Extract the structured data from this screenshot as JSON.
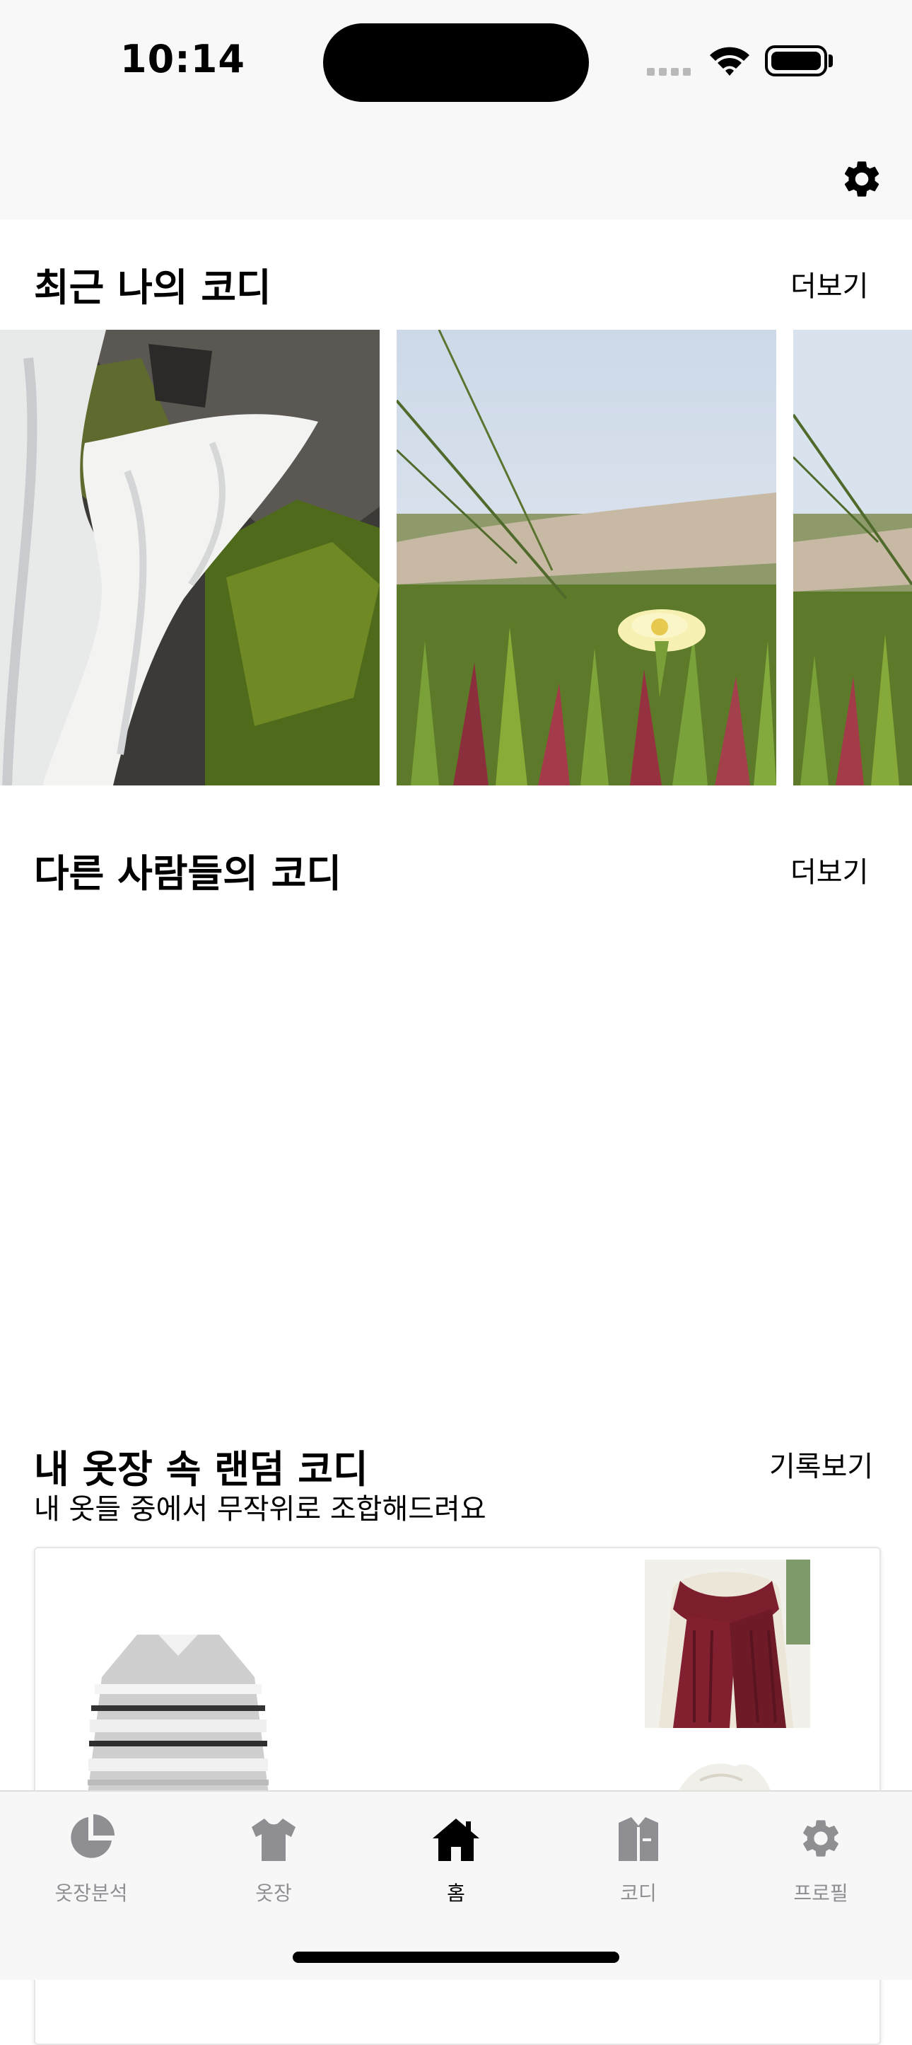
{
  "status_bar": {
    "time": "10:14"
  },
  "top_nav": {
    "settings_icon": "gear-icon"
  },
  "recent": {
    "title": "최근 나의 코디",
    "more_label": "더보기",
    "photos": [
      "waterfall-photo",
      "iceplant-flower-photo",
      "iceplant-flower-photo"
    ]
  },
  "others": {
    "title": "다른 사람들의 코디",
    "more_label": "더보기"
  },
  "random": {
    "title": "내 옷장 속 랜덤 코디",
    "history_label": "기록보기",
    "subtitle": "내 옷들 중에서 무작위로 조합해드려요",
    "items": [
      "striped-sweater",
      "burgundy-knit-scarf",
      "white-item"
    ]
  },
  "tabs": [
    {
      "label": "옷장분석",
      "icon": "pie-chart-icon",
      "active": false
    },
    {
      "label": "옷장",
      "icon": "tshirt-icon",
      "active": false
    },
    {
      "label": "홈",
      "icon": "house-icon",
      "active": true
    },
    {
      "label": "코디",
      "icon": "outfit-icon",
      "active": false
    },
    {
      "label": "프로필",
      "icon": "gear-icon",
      "active": false
    }
  ],
  "colors": {
    "tab_inactive": "#8e8e93",
    "tab_active": "#000000",
    "nav_bg": "#f8f8f8"
  }
}
